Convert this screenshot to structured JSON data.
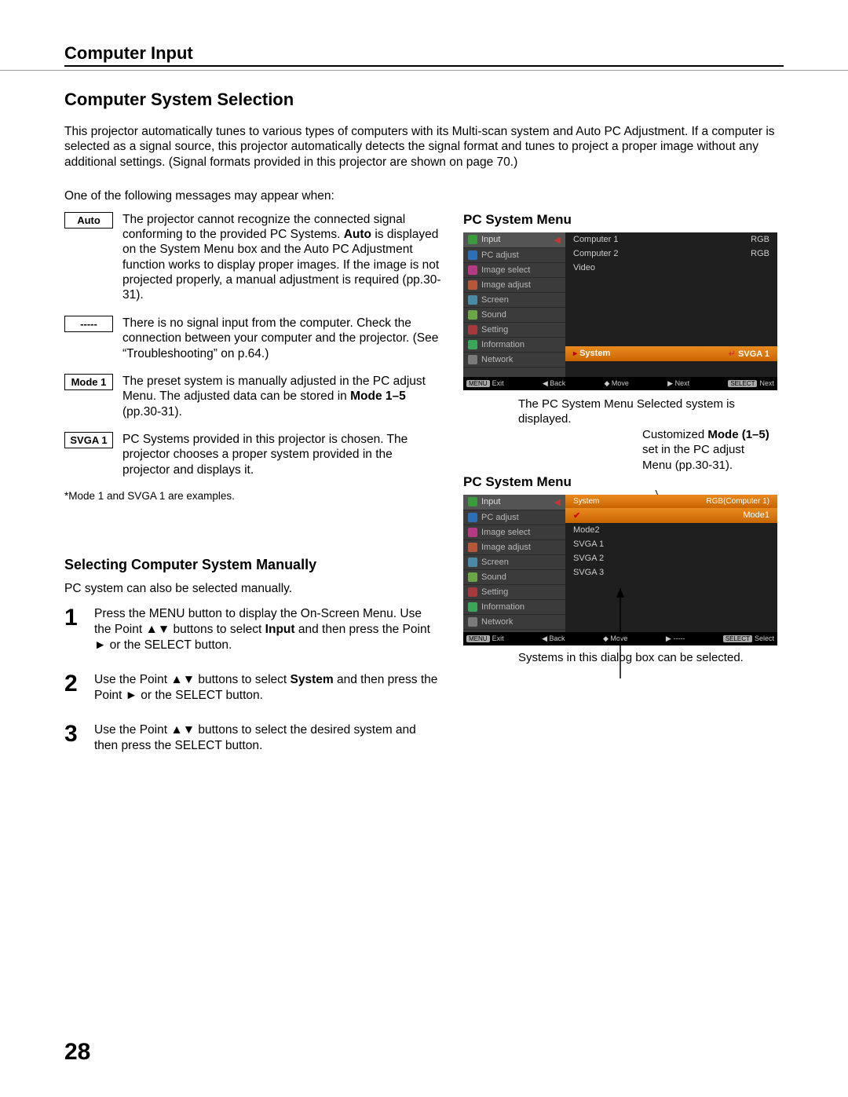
{
  "header": {
    "section": "Computer Input"
  },
  "title": "Computer System Selection",
  "intro": "This projector automatically tunes to various types of computers with its Multi-scan system and Auto PC Adjustment. If a computer is selected as a signal source, this projector automatically detects the signal format and tunes to project a proper image without any additional settings. (Signal formats provided in this projector are shown on page 70.)",
  "msg_intro": "One of the following messages may appear when:",
  "messages": [
    {
      "label": "Auto",
      "text_parts": [
        "The projector cannot recognize the connected signal conforming to the provided PC Systems. ",
        "Auto",
        " is displayed on the System Menu box and the Auto PC Adjustment function works to display proper images. If the image is not projected properly, a manual adjustment is required (pp.30-31)."
      ]
    },
    {
      "label": "-----",
      "text_parts": [
        "There is no signal input from the computer. Check the connection between your computer and the projector. (See “Troubleshooting” on p.64.)"
      ]
    },
    {
      "label": "Mode 1",
      "text_parts": [
        "The preset system is manually adjusted in the PC adjust Menu. The adjusted data can be stored in ",
        "Mode 1–5",
        " (pp.30-31)."
      ]
    },
    {
      "label": "SVGA 1",
      "text_parts": [
        "PC Systems provided in this projector is chosen. The projector chooses a proper system provided in the projector and displays it."
      ]
    }
  ],
  "footnote": "*Mode 1 and SVGA 1 are examples.",
  "manual": {
    "title": "Selecting Computer System Manually",
    "intro": "PC system can also be selected manually.",
    "steps": [
      {
        "num": "1",
        "parts": [
          "Press the MENU button to display the On-Screen Menu. Use the Point ▲▼ buttons to select ",
          "Input",
          " and then press the Point ► or the SELECT button."
        ]
      },
      {
        "num": "2",
        "parts": [
          "Use the Point ▲▼ buttons to select ",
          "System",
          " and then press the Point ► or the SELECT button."
        ]
      },
      {
        "num": "3",
        "parts": [
          "Use the Point ▲▼ buttons to select the desired system and then press the SELECT button."
        ]
      }
    ]
  },
  "right": {
    "menu_title": "PC System Menu",
    "caption1": "The PC System Menu Selected system is displayed.",
    "note_parts": [
      "Customized ",
      "Mode (1–5)",
      " set in the PC adjust Menu (pp.30-31)."
    ],
    "caption2": "Systems in this dialog box can be selected."
  },
  "osd_left_items": [
    "Input",
    "PC adjust",
    "Image select",
    "Image adjust",
    "Screen",
    "Sound",
    "Setting",
    "Information",
    "Network"
  ],
  "osd_icon_colors": [
    "#3a9b3a",
    "#2b6fb5",
    "#b53a84",
    "#b5583a",
    "#4a8aa6",
    "#6aa646",
    "#a63a3a",
    "#3aa65a",
    "#7a7a7a"
  ],
  "osd1": {
    "right_rows": [
      {
        "l": "Computer 1",
        "r": "RGB"
      },
      {
        "l": "Computer 2",
        "r": "RGB"
      },
      {
        "l": "Video",
        "r": ""
      }
    ],
    "system_label": "System",
    "system_value": "SVGA 1",
    "footer": [
      "MENU Exit",
      "◀ Back",
      "◆ Move",
      "▶ Next",
      "SELECT Next"
    ]
  },
  "osd2": {
    "title_l": "System",
    "title_r": "RGB(Computer 1)",
    "rows": [
      "Mode1",
      "Mode2",
      "SVGA 1",
      "SVGA 2",
      "SVGA 3"
    ],
    "footer": [
      "MENU Exit",
      "◀ Back",
      "◆ Move",
      "▶ -----",
      "SELECT Select"
    ]
  },
  "page_num": "28"
}
